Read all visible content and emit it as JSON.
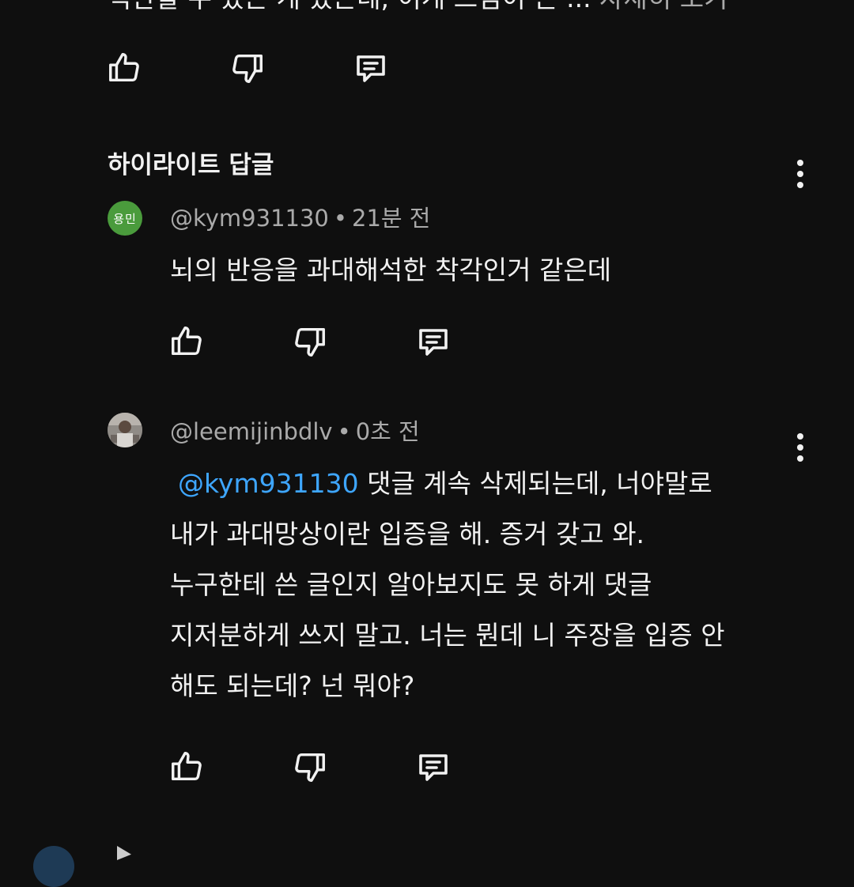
{
  "top_comment": {
    "partial_text": "직관할 수 있는 게 있는데, 이게 느낌이 든 ...",
    "more_label": "자세히 보기"
  },
  "highlight_section": {
    "title": "하이라이트 답글"
  },
  "comments": [
    {
      "avatar_text": "용민",
      "avatar_color": "#4a9b3c",
      "username": "@kym931130",
      "separator": "•",
      "time": "21분 전",
      "text": "뇌의 반응을 과대해석한 착각인거 같은데"
    },
    {
      "username": "@leemijinbdlv",
      "separator": "•",
      "time": "0초 전",
      "mention": "@kym931130",
      "lines": [
        " 댓글 계속 삭제되는데, 너야말로",
        "내가 과대망상이란 입증을 해. 증거 갖고 와.",
        "누구한테 쓴 글인지 알아보지도 못 하게 댓글",
        "지저분하게 쓰지 말고. 너는 뭔데 니 주장을 입증 안",
        "해도 되는데? 넌 뭐야?"
      ]
    }
  ],
  "icons": {
    "like": "thumbs-up-icon",
    "dislike": "thumbs-down-icon",
    "reply": "reply-comment-icon",
    "menu": "more-vert-icon"
  },
  "colors": {
    "background": "#0f0f0f",
    "text": "#f1f1f1",
    "meta": "#aaaaaa",
    "mention": "#3ea6ff"
  }
}
